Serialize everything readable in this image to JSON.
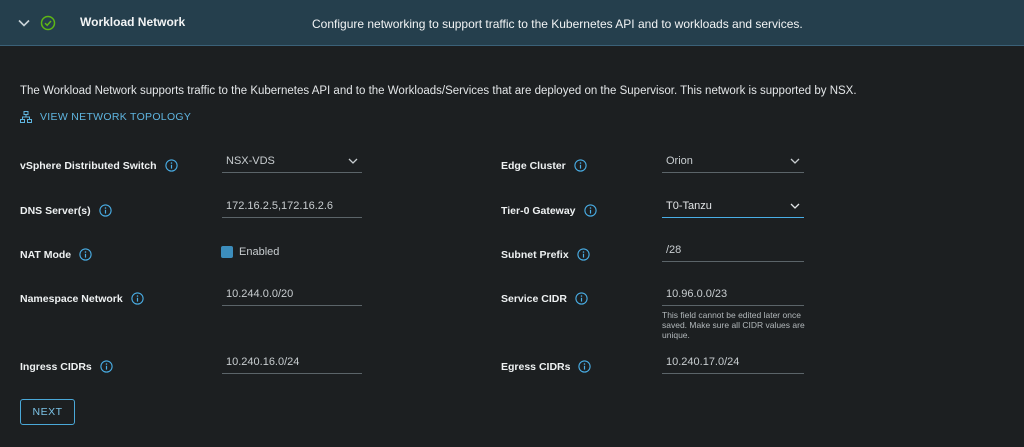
{
  "header": {
    "title": "Workload Network",
    "description": "Configure networking to support traffic to the Kubernetes API and to workloads and services."
  },
  "intro": "The Workload Network supports traffic to the Kubernetes API and to the Workloads/Services that are deployed on the Supervisor. This network is supported by NSX.",
  "topology_link": "VIEW NETWORK TOPOLOGY",
  "left": {
    "vds_label": "vSphere Distributed Switch",
    "vds_value": "NSX-VDS",
    "dns_label": "DNS Server(s)",
    "dns_value": "172.16.2.5,172.16.2.6",
    "nat_label": "NAT Mode",
    "nat_value": "Enabled",
    "ns_label": "Namespace Network",
    "ns_value": "10.244.0.0/20",
    "ingress_label": "Ingress CIDRs",
    "ingress_value": "10.240.16.0/24"
  },
  "right": {
    "edge_label": "Edge Cluster",
    "edge_value": "Orion",
    "tier0_label": "Tier-0 Gateway",
    "tier0_value": "T0-Tanzu",
    "subnet_label": "Subnet Prefix",
    "subnet_value": "/28",
    "service_label": "Service CIDR",
    "service_value": "10.96.0.0/23",
    "service_hint": "This field cannot be edited later once saved. Make sure all CIDR values are unique.",
    "egress_label": "Egress CIDRs",
    "egress_value": "10.240.17.0/24"
  },
  "next_button": "NEXT",
  "colors": {
    "background": "#1c1f21",
    "header": "#253f4d",
    "accent": "#49aee6",
    "success": "#5eb715"
  }
}
